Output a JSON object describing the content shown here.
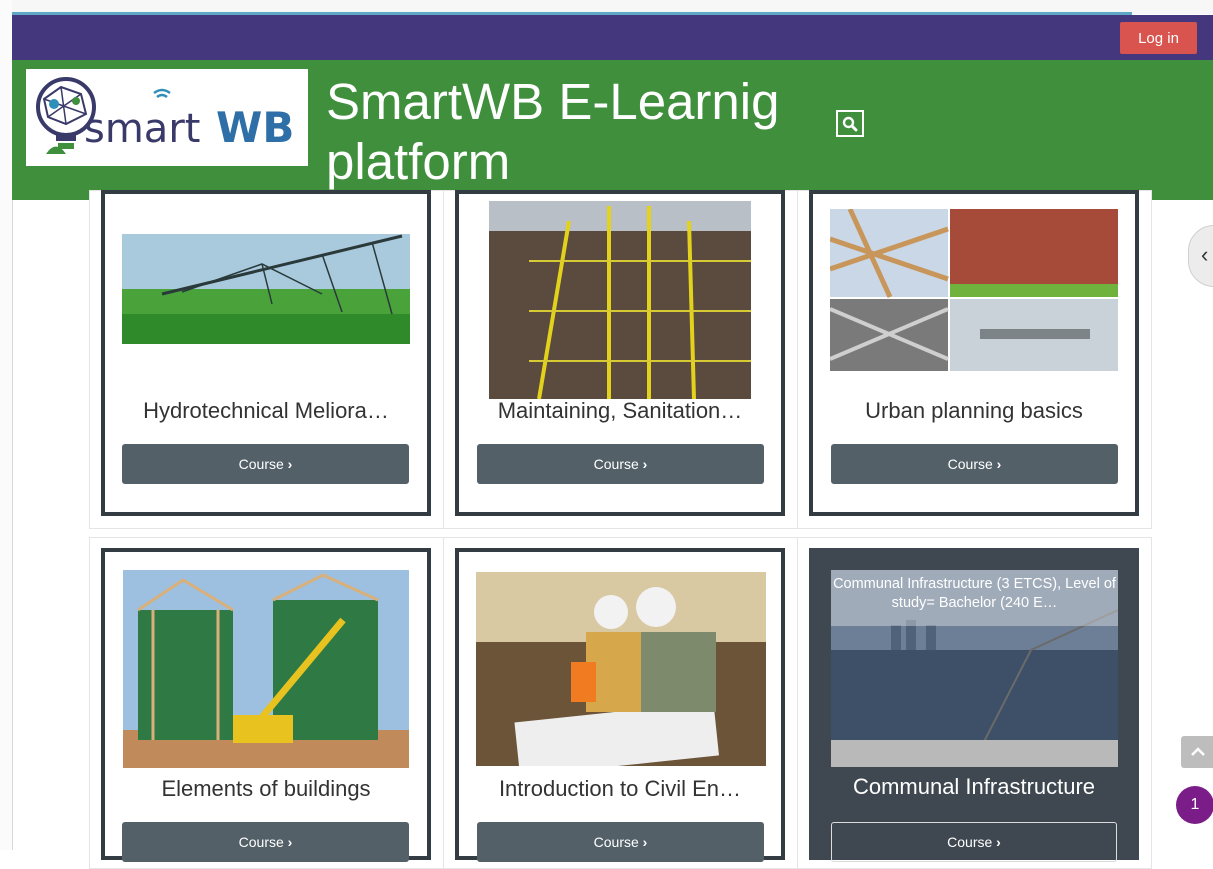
{
  "topbar": {
    "login_label": "Log in"
  },
  "header": {
    "logo_text": "smartWB",
    "site_title": "SmartWB E-Learnig platform",
    "search_icon": "search-icon"
  },
  "courses": [
    {
      "title": "Hydrotechnical Meliora…",
      "button": "Course"
    },
    {
      "title": "Maintaining, Sanitation…",
      "button": "Course"
    },
    {
      "title": "Urban planning basics",
      "button": "Course"
    },
    {
      "title": "Elements of buildings",
      "button": "Course"
    },
    {
      "title": "Introduction to Civil En…",
      "button": "Course"
    },
    {
      "title": "Communal Infrastructure",
      "button": "Course",
      "hover_description": "Communal Infrastructure (3 ETCS), Level of study= Bachelor (240 E…"
    }
  ],
  "floating": {
    "drawer_icon": "chevron-left-icon",
    "scroll_top_icon": "chevron-up-icon",
    "badge_count": "1"
  },
  "colors": {
    "topbar": "#44377e",
    "header": "#3f8f3d",
    "login": "#d9534f",
    "course_button": "#536068",
    "badge": "#7b1d88"
  }
}
